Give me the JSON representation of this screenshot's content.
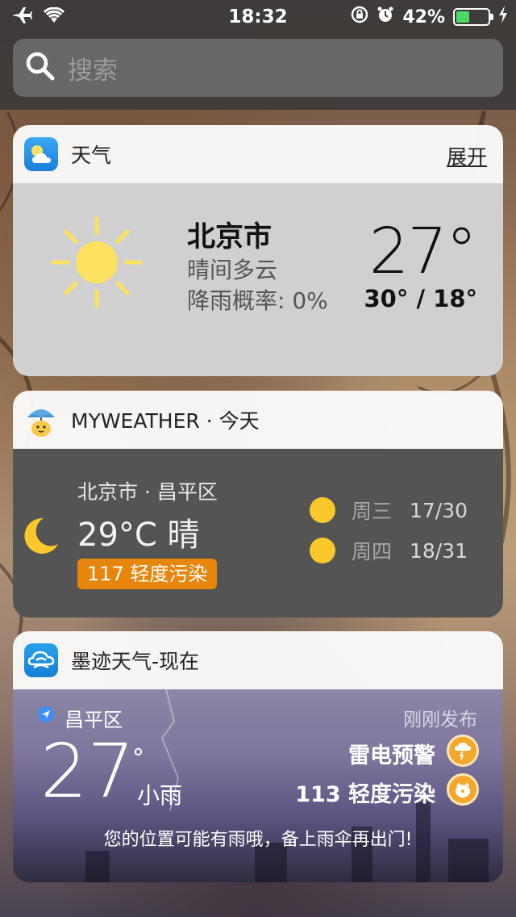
{
  "status_bar": {
    "time": "18:32",
    "battery_percent": "42%",
    "battery_level": 0.42,
    "icons": [
      "airplane-icon",
      "wifi-icon",
      "rotation-lock-icon",
      "alarm-icon",
      "battery-icon",
      "charging-icon"
    ]
  },
  "search": {
    "placeholder": "搜索"
  },
  "widgets": {
    "weather": {
      "title": "天气",
      "expand_label": "展开",
      "city": "北京市",
      "condition": "晴间多云",
      "rain_chance": "降雨概率: 0%",
      "temperature": "27°",
      "range": "30° / 18°"
    },
    "myweather": {
      "title": "MYWEATHER · 今天",
      "location": "北京市 · 昌平区",
      "current": "29°C 晴",
      "aqi": "117 轻度污染",
      "aqi_color": "#e8860c",
      "forecast": [
        {
          "day": "周三",
          "temps": "17/30"
        },
        {
          "day": "周四",
          "temps": "18/31"
        }
      ]
    },
    "moji": {
      "title": "墨迹天气-现在",
      "location": "昌平区",
      "temperature": "27",
      "degree_symbol": "°",
      "condition": "小雨",
      "posted": "刚刚发布",
      "alert": "雷电预警",
      "aqi": "113 轻度污染",
      "tip": "您的位置可能有雨哦，备上雨伞再出门!"
    }
  },
  "colors": {
    "sun_yellow": "#fde160",
    "forecast_sun": "#fbc82c",
    "badge_orange": "#f3a72c"
  }
}
